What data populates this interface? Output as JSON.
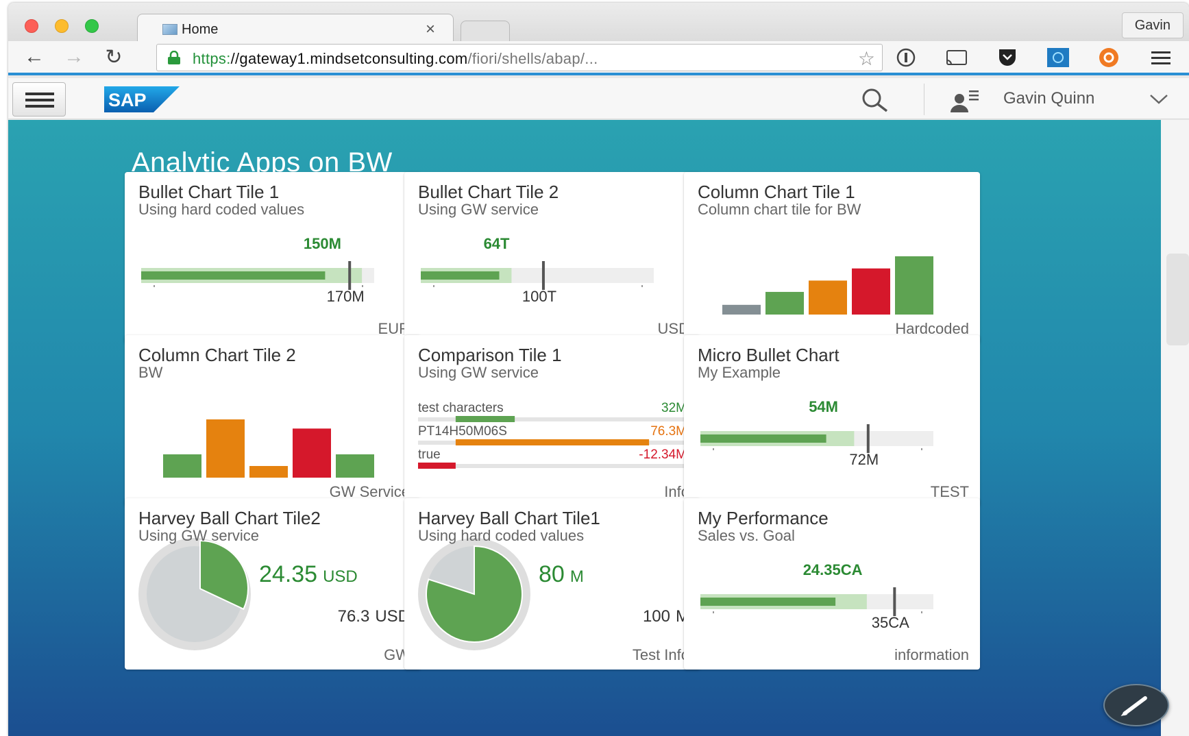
{
  "browser": {
    "tab_title": "Home",
    "tab_close": "×",
    "profile_label": "Gavin",
    "url_scheme": "https:",
    "url_host": "//gateway1.mindsetconsulting.com",
    "url_path": "/fiori/shells/abap/...",
    "icons": [
      "back-icon",
      "forward-icon",
      "reload-icon",
      "lock-icon",
      "star-icon",
      "info-icon",
      "cast-icon",
      "pocket-icon",
      "extension-icon",
      "lastpass-icon",
      "menu-icon"
    ]
  },
  "shell": {
    "logo_text": "SAP",
    "user_name": "Gavin Quinn"
  },
  "group_title": "Analytic Apps on BW",
  "colors": {
    "green": "#5ea352",
    "green_light": "#c6e3bf",
    "green_text": "#2b8a33",
    "orange": "#e5820f",
    "red": "#d5182b",
    "grey": "#848f94",
    "red_text": "#d5182b",
    "orange_text": "#e5720f"
  },
  "tiles": [
    {
      "title": "Bullet Chart Tile 1",
      "subtitle": "Using hard coded values",
      "footer": "EUR",
      "kind": "bullet",
      "actual_label": "150M",
      "target_label": "170M",
      "actual": 150,
      "target": 170,
      "forecast": 180,
      "max": 190
    },
    {
      "title": "Bullet Chart Tile 2",
      "subtitle": "Using GW service",
      "footer": "USD",
      "kind": "bullet",
      "actual_label": "64T",
      "target_label": "100T",
      "actual": 64,
      "target": 100,
      "forecast": 74,
      "max": 190
    },
    {
      "title": "Column Chart Tile 1",
      "subtitle": "Column chart tile for BW",
      "footer": "Hardcoded",
      "kind": "column",
      "values": [
        12,
        28,
        42,
        57,
        72
      ],
      "colors": [
        "grey",
        "green",
        "orange",
        "red",
        "green"
      ]
    },
    {
      "title": "Column Chart Tile 2",
      "subtitle": "BW",
      "footer": "GW Service",
      "kind": "column",
      "values": [
        28,
        70,
        14,
        59,
        28
      ],
      "colors": [
        "green",
        "orange",
        "orange",
        "red",
        "green"
      ]
    },
    {
      "title": "Comparison Tile 1",
      "subtitle": "Using GW service",
      "footer": "Info",
      "kind": "comparison",
      "rows": [
        {
          "label": "test characters",
          "value": "32M",
          "fraction": 0.36,
          "start": 0.14,
          "color": "green"
        },
        {
          "label": "PT14H50M06S",
          "value": "76.3M",
          "fraction": 0.86,
          "start": 0.14,
          "color": "orange"
        },
        {
          "label": "true",
          "value": "-12.34M",
          "fraction": 0.14,
          "start": 0.0,
          "color": "red"
        }
      ]
    },
    {
      "title": "Micro Bullet Chart",
      "subtitle": "My Example",
      "footer": "TEST",
      "kind": "bullet",
      "actual_label": "54M",
      "target_label": "72M",
      "actual": 54,
      "target": 72,
      "forecast": 66,
      "max": 100
    },
    {
      "title": "Harvey Ball Chart Tile2",
      "subtitle": "Using GW service",
      "footer": "GW",
      "kind": "harvey",
      "value": "24.35",
      "value_unit": "USD",
      "total": "76.3",
      "total_unit": "USD",
      "fraction": 0.32
    },
    {
      "title": "Harvey Ball Chart Tile1",
      "subtitle": "Using hard coded values",
      "footer": "Test Info",
      "kind": "harvey",
      "value": "80",
      "value_unit": "M",
      "total": "100",
      "total_unit": "M",
      "fraction": 0.8
    },
    {
      "title": "My Performance",
      "subtitle": "Sales vs. Goal",
      "footer": "information",
      "kind": "bullet",
      "actual_label": "24.35CA",
      "target_label": "35CA",
      "actual": 24.35,
      "target": 35,
      "forecast": 30,
      "max": 42
    }
  ]
}
